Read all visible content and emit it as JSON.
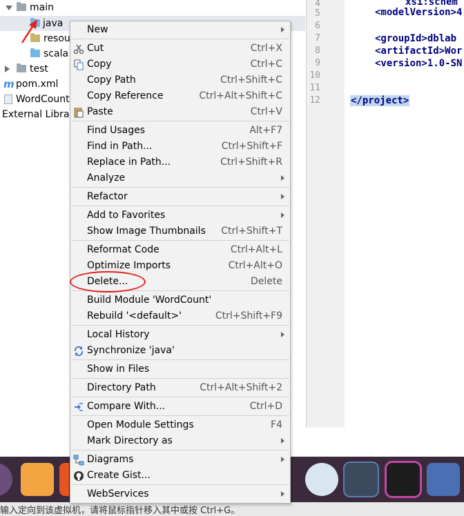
{
  "tree": {
    "main": "main",
    "java": "java",
    "resources": "resou",
    "scala": "scala",
    "test": "test",
    "pom": "pom.xml",
    "wordcount": "WordCount",
    "external": "External Librai"
  },
  "editor": {
    "lines": [
      {
        "n": "4",
        "code": "xsi:schem"
      },
      {
        "n": "5",
        "code": "<modelVersion>4"
      },
      {
        "n": "6",
        "code": ""
      },
      {
        "n": "7",
        "code": "<groupId>dblab"
      },
      {
        "n": "8",
        "code": "<artifactId>Wor"
      },
      {
        "n": "9",
        "code": "<version>1.0-SN"
      },
      {
        "n": "10",
        "code": ""
      },
      {
        "n": "11",
        "code": ""
      },
      {
        "n": "12",
        "code": "</project>"
      }
    ]
  },
  "menu": {
    "new": {
      "label": "New"
    },
    "cut": {
      "label": "Cut",
      "shortcut": "Ctrl+X"
    },
    "copy": {
      "label": "Copy",
      "shortcut": "Ctrl+C"
    },
    "copy_path": {
      "label": "Copy Path",
      "shortcut": "Ctrl+Shift+C"
    },
    "copy_reference": {
      "label": "Copy Reference",
      "shortcut": "Ctrl+Alt+Shift+C"
    },
    "paste": {
      "label": "Paste",
      "shortcut": "Ctrl+V"
    },
    "find_usages": {
      "label": "Find Usages",
      "shortcut": "Alt+F7"
    },
    "find_in_path": {
      "label": "Find in Path...",
      "shortcut": "Ctrl+Shift+F"
    },
    "replace_in_path": {
      "label": "Replace in Path...",
      "shortcut": "Ctrl+Shift+R"
    },
    "analyze": {
      "label": "Analyze"
    },
    "refactor": {
      "label": "Refactor"
    },
    "add_to_favorites": {
      "label": "Add to Favorites"
    },
    "show_image_thumbnails": {
      "label": "Show Image Thumbnails",
      "shortcut": "Ctrl+Shift+T"
    },
    "reformat_code": {
      "label": "Reformat Code",
      "shortcut": "Ctrl+Alt+L"
    },
    "optimize_imports": {
      "label": "Optimize Imports",
      "shortcut": "Ctrl+Alt+O"
    },
    "delete": {
      "label": "Delete...",
      "shortcut": "Delete"
    },
    "build_module": {
      "label": "Build Module 'WordCount'"
    },
    "rebuild": {
      "label": "Rebuild '<default>'",
      "shortcut": "Ctrl+Shift+F9"
    },
    "local_history": {
      "label": "Local History"
    },
    "synchronize": {
      "label": "Synchronize 'java'"
    },
    "show_in_files": {
      "label": "Show in Files"
    },
    "directory_path": {
      "label": "Directory Path",
      "shortcut": "Ctrl+Alt+Shift+2"
    },
    "compare_with": {
      "label": "Compare With...",
      "shortcut": "Ctrl+D"
    },
    "open_module_settings": {
      "label": "Open Module Settings",
      "shortcut": "F4"
    },
    "mark_directory_as": {
      "label": "Mark Directory as"
    },
    "diagrams": {
      "label": "Diagrams"
    },
    "create_gist": {
      "label": "Create Gist..."
    },
    "webservices": {
      "label": "WebServices"
    }
  },
  "statusbar": {
    "text": "输入定向到该虚拟机，请将鼠标指针移入其中或按 Ctrl+G。"
  },
  "colors": {
    "annotation_red": "#e2231a",
    "folder_blue": "#6fb8e8",
    "dock_bg": "#3a2a3c"
  }
}
